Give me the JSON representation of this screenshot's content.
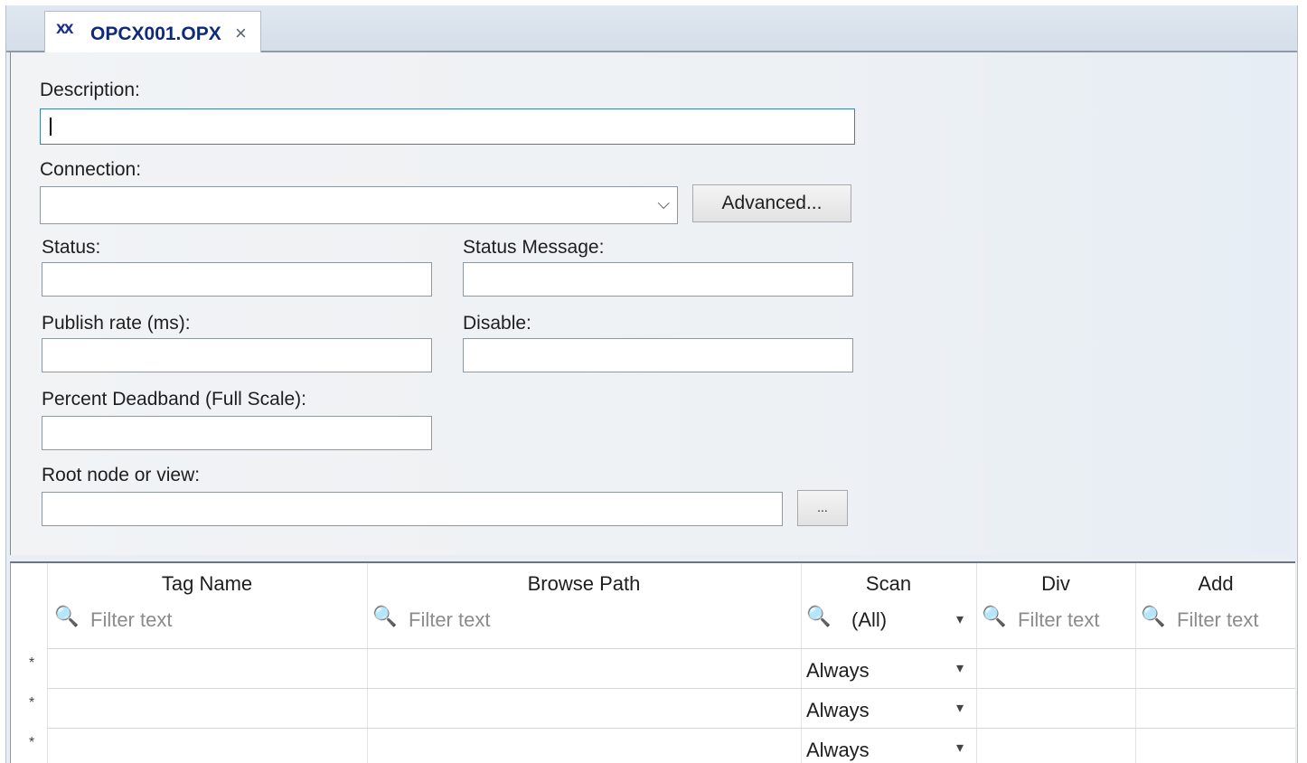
{
  "tab": {
    "icon": "opc-logo-icon",
    "title": "OPCX001.OPX",
    "close": "×"
  },
  "form": {
    "description_label": "Description:",
    "description_value": "",
    "connection_label": "Connection:",
    "connection_value": "",
    "advanced_button": "Advanced...",
    "status_label": "Status:",
    "status_value": "",
    "status_message_label": "Status Message:",
    "status_message_value": "",
    "publish_rate_label": "Publish rate (ms):",
    "publish_rate_value": "",
    "disable_label": "Disable:",
    "disable_value": "",
    "deadband_label": "Percent Deadband (Full Scale):",
    "deadband_value": "",
    "root_label": "Root node or view:",
    "root_value": "",
    "browse_button": "..."
  },
  "grid": {
    "columns": [
      "Tag Name",
      "Browse Path",
      "Scan",
      "Div",
      "Add"
    ],
    "filter_placeholder": "Filter text",
    "scan_filter": "(All)",
    "rows": [
      {
        "marker": "*",
        "scan": "Always"
      },
      {
        "marker": "*",
        "scan": "Always"
      },
      {
        "marker": "*",
        "scan": "Always"
      }
    ]
  }
}
